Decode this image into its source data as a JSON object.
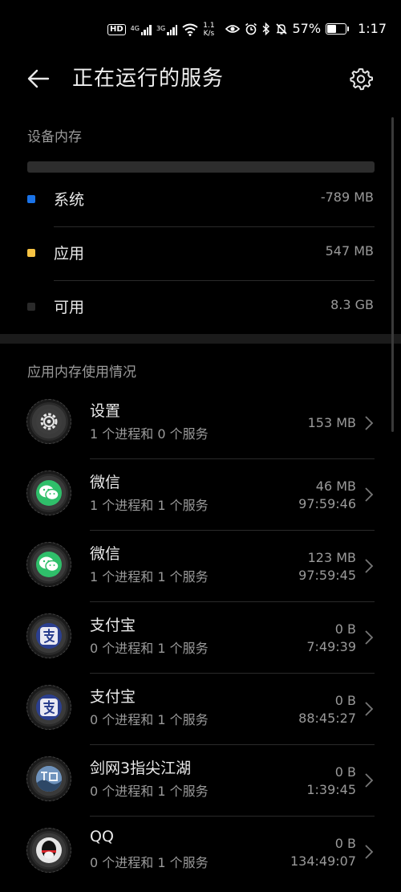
{
  "status_bar": {
    "hd_label": "HD",
    "net1": "4G",
    "net2": "3G",
    "speed_top": "1.1",
    "speed_unit": "K/s",
    "battery_percent": "57%",
    "battery_level": 0.57,
    "time": "1:17",
    "icons": [
      "eye-icon",
      "alarm-icon",
      "bluetooth-icon",
      "mute-bell-icon"
    ]
  },
  "header": {
    "title": "正在运行的服务",
    "back_icon": "arrow-left-icon",
    "settings_icon": "gear-icon"
  },
  "device_memory": {
    "label": "设备内存",
    "items": [
      {
        "name": "系统",
        "value": "-789 MB",
        "color": "#1a73e8"
      },
      {
        "name": "应用",
        "value": "547 MB",
        "color": "#f6c343"
      },
      {
        "name": "可用",
        "value": "8.3 GB",
        "color": "#2a2a2a"
      }
    ]
  },
  "app_memory": {
    "label": "应用内存使用情况",
    "apps": [
      {
        "name": "设置",
        "sub": "1 个进程和 0 个服务",
        "size": "153 MB",
        "time": "",
        "icon": "settings-app-icon"
      },
      {
        "name": "微信",
        "sub": "1 个进程和 1 个服务",
        "size": "46 MB",
        "time": "97:59:46",
        "icon": "wechat-app-icon"
      },
      {
        "name": "微信",
        "sub": "1 个进程和 1 个服务",
        "size": "123 MB",
        "time": "97:59:45",
        "icon": "wechat-app-icon"
      },
      {
        "name": "支付宝",
        "sub": "0 个进程和 1 个服务",
        "size": "0 B",
        "time": "7:49:39",
        "icon": "alipay-app-icon"
      },
      {
        "name": "支付宝",
        "sub": "0 个进程和 1 个服务",
        "size": "0 B",
        "time": "88:45:27",
        "icon": "alipay-app-icon"
      },
      {
        "name": "剑网3指尖江湖",
        "sub": "0 个进程和 1 个服务",
        "size": "0 B",
        "time": "1:39:45",
        "icon": "game-app-icon"
      },
      {
        "name": "QQ",
        "sub": "0 个进程和 1 个服务",
        "size": "0 B",
        "time": "134:49:07",
        "icon": "qq-app-icon"
      }
    ]
  }
}
